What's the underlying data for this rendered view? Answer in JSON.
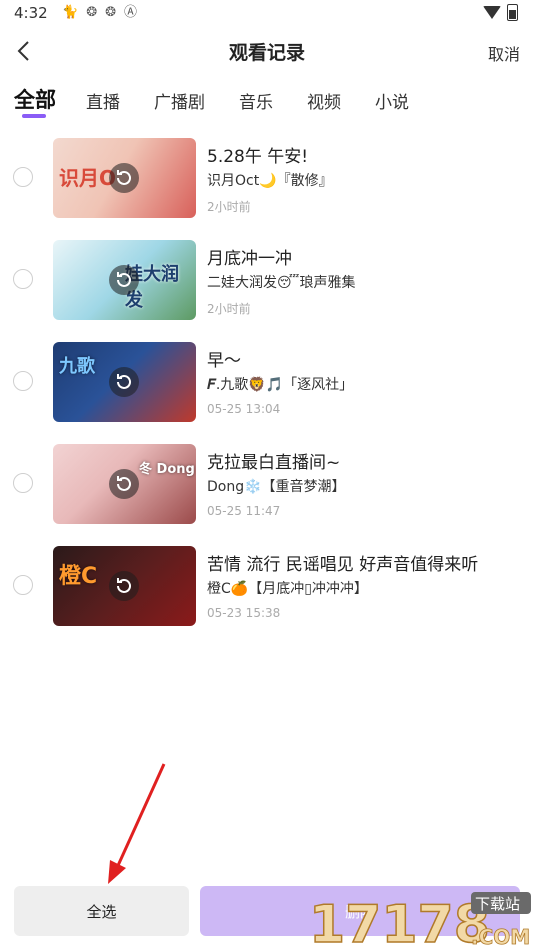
{
  "status_bar": {
    "time": "4:32",
    "icons": [
      "signal-cat-icon",
      "sync-icon",
      "sync-icon",
      "a-icon"
    ]
  },
  "header": {
    "title": "观看记录",
    "cancel_label": "取消"
  },
  "tabs": [
    {
      "label": "全部",
      "active": true
    },
    {
      "label": "直播",
      "active": false
    },
    {
      "label": "广播剧",
      "active": false
    },
    {
      "label": "音乐",
      "active": false
    },
    {
      "label": "视频",
      "active": false
    },
    {
      "label": "小说",
      "active": false
    }
  ],
  "items": [
    {
      "title": "5.28午 午安!",
      "subtitle": "识月Oct🌙『散修』",
      "time": "2小时前",
      "thumb_text": "识月O",
      "thumb_colors": [
        "#f3d9cf",
        "#d8605a"
      ]
    },
    {
      "title": "月底冲一冲",
      "subtitle": "二娃大润发😴琅声雅集",
      "time": "2小时前",
      "thumb_text": "娃大润发",
      "thumb_colors": [
        "#9fd7e6",
        "#5d9a62"
      ]
    },
    {
      "title": "早～",
      "subtitle": "𝑭.九歌🦁🎵「逐风社」",
      "time": "05-25 13:04",
      "thumb_text": "九歌",
      "thumb_colors": [
        "#1e3c72",
        "#c0392b"
      ]
    },
    {
      "title": "克拉最白直播间~",
      "subtitle": "Dong❄️【重音梦潮】",
      "time": "05-25 11:47",
      "thumb_text": "冬 Dong",
      "thumb_colors": [
        "#e8b9b9",
        "#9b4a4a"
      ]
    },
    {
      "title": "苦情 流行 民谣唱见 好声音值得来听",
      "subtitle": "橙C🍊【月底冲▯冲冲冲】",
      "time": "05-23 15:38",
      "thumb_text": "橙C",
      "thumb_colors": [
        "#2a1a1a",
        "#8b1a1a"
      ]
    }
  ],
  "footer": {
    "select_all_label": "全选",
    "delete_label": "删除"
  },
  "watermark": {
    "text": "17178",
    "sub": ".COM",
    "badge": "下载站"
  },
  "colors": {
    "accent": "#8a5cf6",
    "delete_bg": "#cdb8f5",
    "arrow": "#e02020"
  }
}
